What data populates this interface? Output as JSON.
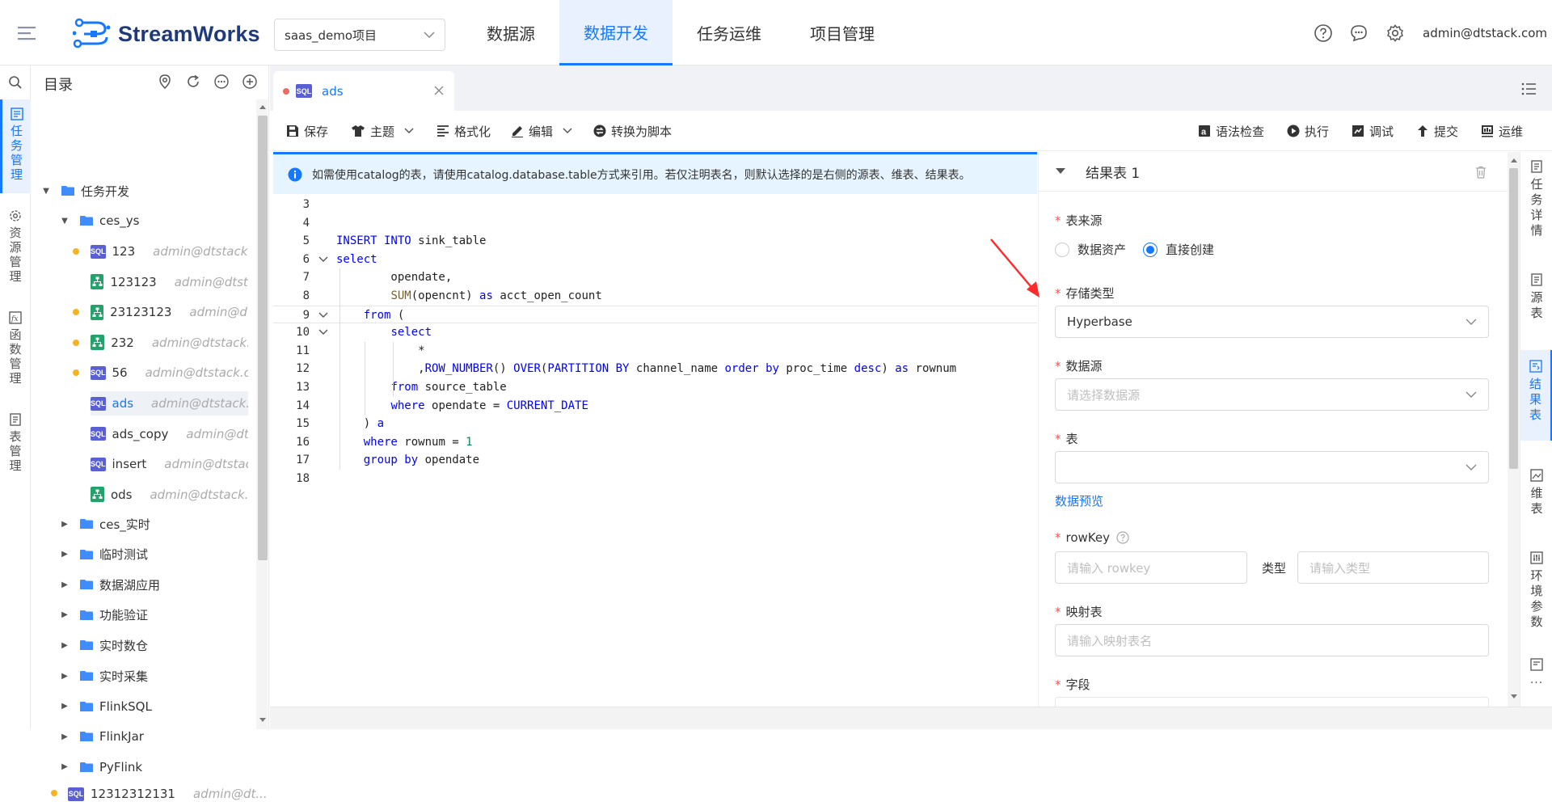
{
  "app": {
    "name": "StreamWorks",
    "project": "saas_demo项目",
    "user": "admin@dtstack.com"
  },
  "nav": [
    {
      "label": "数据源",
      "active": false
    },
    {
      "label": "数据开发",
      "active": true
    },
    {
      "label": "任务运维",
      "active": false
    },
    {
      "label": "项目管理",
      "active": false
    }
  ],
  "sidebar": [
    {
      "label": "任务管理",
      "icon": "task-icon",
      "active": true
    },
    {
      "label": "资源管理",
      "icon": "gear-icon",
      "active": false
    },
    {
      "label": "函数管理",
      "icon": "function-icon",
      "active": false
    },
    {
      "label": "表管理",
      "icon": "table-icon",
      "active": false
    }
  ],
  "tree": {
    "title": "目录",
    "root": "任务开发",
    "folder": "ces_ys",
    "items": [
      {
        "name": "123",
        "owner": "admin@dtstack...",
        "type": "sql",
        "dot": true
      },
      {
        "name": "123123",
        "owner": "admin@dtst...",
        "type": "flow",
        "dot": false
      },
      {
        "name": "23123123",
        "owner": "admin@d...",
        "type": "flow",
        "dot": true
      },
      {
        "name": "232",
        "owner": "admin@dtstack...",
        "type": "flow",
        "dot": true
      },
      {
        "name": "56",
        "owner": "admin@dtstack.c...",
        "type": "sql",
        "dot": true
      },
      {
        "name": "ads",
        "owner": "admin@dtstack....",
        "type": "sql",
        "dot": false,
        "selected": true
      },
      {
        "name": "ads_copy",
        "owner": "admin@dt...",
        "type": "sql",
        "dot": false
      },
      {
        "name": "insert",
        "owner": "admin@dtstac...",
        "type": "sql",
        "dot": false
      },
      {
        "name": "ods",
        "owner": "admin@dtstack....",
        "type": "flow",
        "dot": false
      }
    ],
    "folders": [
      "ces_实时",
      "临时测试",
      "数据湖应用",
      "功能验证",
      "实时数仓",
      "实时采集",
      "FlinkSQL",
      "FlinkJar",
      "PyFlink"
    ],
    "last_item": "12312312131",
    "last_owner": "admin@dt..."
  },
  "tab": {
    "label": "ads",
    "badge": "SQL"
  },
  "toolbar": {
    "left": [
      "保存",
      "主题",
      "格式化",
      "编辑",
      "转换为脚本"
    ],
    "right": [
      "语法检查",
      "执行",
      "调试",
      "提交",
      "运维"
    ]
  },
  "info": "如需使用catalog的表，请使用catalog.database.table方式来引用。若仅注明表名，则默认选择的是右侧的源表、维表、结果表。",
  "code": {
    "lines": [
      {
        "n": "3",
        "html": ""
      },
      {
        "n": "4",
        "html": ""
      },
      {
        "n": "5",
        "html": "<span class='kw'>INSERT INTO</span> sink_table"
      },
      {
        "n": "6",
        "html": "<span class='kw'>select</span>",
        "fold": true
      },
      {
        "n": "7",
        "html": "        opendate,"
      },
      {
        "n": "8",
        "html": "        <span class='fn'>SUM</span>(opencnt) <span class='kw'>as</span> acct_open_count"
      },
      {
        "n": "9",
        "html": "    <span class='kw'>from</span> (",
        "fold": true,
        "hl": true
      },
      {
        "n": "10",
        "html": "        <span class='kw'>select</span>",
        "fold": true
      },
      {
        "n": "11",
        "html": "            *"
      },
      {
        "n": "12",
        "html": "            ,<span class='kw'>ROW_NUMBER</span>() <span class='kw'>OVER</span>(<span class='kw'>PARTITION BY</span> channel_name <span class='kw'>order by</span> proc_time <span class='kw'>desc</span>) <span class='kw'>as</span> rownum"
      },
      {
        "n": "13",
        "html": "        <span class='kw'>from</span> source_table"
      },
      {
        "n": "14",
        "html": "        <span class='kw'>where</span> opendate = <span class='kw'>CURRENT_DATE</span>"
      },
      {
        "n": "15",
        "html": "    ) <span class='kw'>a</span>"
      },
      {
        "n": "16",
        "html": "    <span class='kw'>where</span> rownum = <span class='num'>1</span>"
      },
      {
        "n": "17",
        "html": "    <span class='kw'>group by</span> opendate"
      },
      {
        "n": "18",
        "html": ""
      }
    ]
  },
  "result_panel": {
    "title": "结果表 1",
    "source_label": "表来源",
    "source_options": [
      {
        "label": "数据资产",
        "checked": false
      },
      {
        "label": "直接创建",
        "checked": true
      }
    ],
    "storage_label": "存储类型",
    "storage_value": "Hyperbase",
    "datasource_label": "数据源",
    "datasource_placeholder": "请选择数据源",
    "table_label": "表",
    "preview_link": "数据预览",
    "rowkey_label": "rowKey",
    "rowkey_placeholder": "请输入 rowkey",
    "type_label": "类型",
    "type_placeholder": "请输入类型",
    "mapping_label": "映射表",
    "mapping_placeholder": "请输入映射表名",
    "fields_label": "字段"
  },
  "right_tabs": [
    {
      "label": "任务详情",
      "active": false
    },
    {
      "label": "源表",
      "active": false
    },
    {
      "label": "结果表",
      "active": true
    },
    {
      "label": "维表",
      "active": false
    },
    {
      "label": "环境参数",
      "active": false
    }
  ],
  "colors": {
    "accent": "#1677ff",
    "sql_badge": "#5a5fd1",
    "flow_badge": "#22a36b",
    "dot": "#f5b324",
    "annotation_arrow": "#ff2a2a"
  }
}
